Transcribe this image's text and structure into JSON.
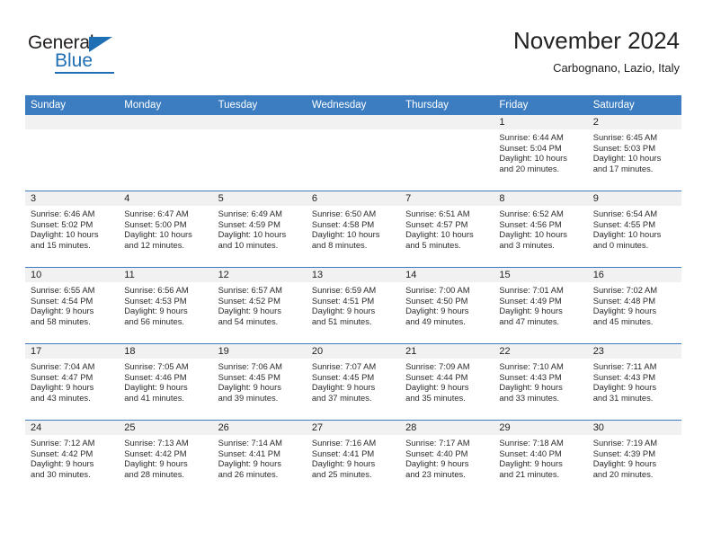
{
  "brand": {
    "name_part1": "General",
    "name_part2": "Blue"
  },
  "header": {
    "title": "November 2024",
    "location": "Carbognano, Lazio, Italy"
  },
  "colors": {
    "header_blue": "#3b7dc0",
    "brand_blue": "#1f6fb5",
    "daynum_band": "#f1f1f1"
  },
  "calendar": {
    "weekday_headers": [
      "Sunday",
      "Monday",
      "Tuesday",
      "Wednesday",
      "Thursday",
      "Friday",
      "Saturday"
    ],
    "weeks": [
      [
        {
          "day": "",
          "lines": []
        },
        {
          "day": "",
          "lines": []
        },
        {
          "day": "",
          "lines": []
        },
        {
          "day": "",
          "lines": []
        },
        {
          "day": "",
          "lines": []
        },
        {
          "day": "1",
          "lines": [
            "Sunrise: 6:44 AM",
            "Sunset: 5:04 PM",
            "Daylight: 10 hours",
            "and 20 minutes."
          ]
        },
        {
          "day": "2",
          "lines": [
            "Sunrise: 6:45 AM",
            "Sunset: 5:03 PM",
            "Daylight: 10 hours",
            "and 17 minutes."
          ]
        }
      ],
      [
        {
          "day": "3",
          "lines": [
            "Sunrise: 6:46 AM",
            "Sunset: 5:02 PM",
            "Daylight: 10 hours",
            "and 15 minutes."
          ]
        },
        {
          "day": "4",
          "lines": [
            "Sunrise: 6:47 AM",
            "Sunset: 5:00 PM",
            "Daylight: 10 hours",
            "and 12 minutes."
          ]
        },
        {
          "day": "5",
          "lines": [
            "Sunrise: 6:49 AM",
            "Sunset: 4:59 PM",
            "Daylight: 10 hours",
            "and 10 minutes."
          ]
        },
        {
          "day": "6",
          "lines": [
            "Sunrise: 6:50 AM",
            "Sunset: 4:58 PM",
            "Daylight: 10 hours",
            "and 8 minutes."
          ]
        },
        {
          "day": "7",
          "lines": [
            "Sunrise: 6:51 AM",
            "Sunset: 4:57 PM",
            "Daylight: 10 hours",
            "and 5 minutes."
          ]
        },
        {
          "day": "8",
          "lines": [
            "Sunrise: 6:52 AM",
            "Sunset: 4:56 PM",
            "Daylight: 10 hours",
            "and 3 minutes."
          ]
        },
        {
          "day": "9",
          "lines": [
            "Sunrise: 6:54 AM",
            "Sunset: 4:55 PM",
            "Daylight: 10 hours",
            "and 0 minutes."
          ]
        }
      ],
      [
        {
          "day": "10",
          "lines": [
            "Sunrise: 6:55 AM",
            "Sunset: 4:54 PM",
            "Daylight: 9 hours",
            "and 58 minutes."
          ]
        },
        {
          "day": "11",
          "lines": [
            "Sunrise: 6:56 AM",
            "Sunset: 4:53 PM",
            "Daylight: 9 hours",
            "and 56 minutes."
          ]
        },
        {
          "day": "12",
          "lines": [
            "Sunrise: 6:57 AM",
            "Sunset: 4:52 PM",
            "Daylight: 9 hours",
            "and 54 minutes."
          ]
        },
        {
          "day": "13",
          "lines": [
            "Sunrise: 6:59 AM",
            "Sunset: 4:51 PM",
            "Daylight: 9 hours",
            "and 51 minutes."
          ]
        },
        {
          "day": "14",
          "lines": [
            "Sunrise: 7:00 AM",
            "Sunset: 4:50 PM",
            "Daylight: 9 hours",
            "and 49 minutes."
          ]
        },
        {
          "day": "15",
          "lines": [
            "Sunrise: 7:01 AM",
            "Sunset: 4:49 PM",
            "Daylight: 9 hours",
            "and 47 minutes."
          ]
        },
        {
          "day": "16",
          "lines": [
            "Sunrise: 7:02 AM",
            "Sunset: 4:48 PM",
            "Daylight: 9 hours",
            "and 45 minutes."
          ]
        }
      ],
      [
        {
          "day": "17",
          "lines": [
            "Sunrise: 7:04 AM",
            "Sunset: 4:47 PM",
            "Daylight: 9 hours",
            "and 43 minutes."
          ]
        },
        {
          "day": "18",
          "lines": [
            "Sunrise: 7:05 AM",
            "Sunset: 4:46 PM",
            "Daylight: 9 hours",
            "and 41 minutes."
          ]
        },
        {
          "day": "19",
          "lines": [
            "Sunrise: 7:06 AM",
            "Sunset: 4:45 PM",
            "Daylight: 9 hours",
            "and 39 minutes."
          ]
        },
        {
          "day": "20",
          "lines": [
            "Sunrise: 7:07 AM",
            "Sunset: 4:45 PM",
            "Daylight: 9 hours",
            "and 37 minutes."
          ]
        },
        {
          "day": "21",
          "lines": [
            "Sunrise: 7:09 AM",
            "Sunset: 4:44 PM",
            "Daylight: 9 hours",
            "and 35 minutes."
          ]
        },
        {
          "day": "22",
          "lines": [
            "Sunrise: 7:10 AM",
            "Sunset: 4:43 PM",
            "Daylight: 9 hours",
            "and 33 minutes."
          ]
        },
        {
          "day": "23",
          "lines": [
            "Sunrise: 7:11 AM",
            "Sunset: 4:43 PM",
            "Daylight: 9 hours",
            "and 31 minutes."
          ]
        }
      ],
      [
        {
          "day": "24",
          "lines": [
            "Sunrise: 7:12 AM",
            "Sunset: 4:42 PM",
            "Daylight: 9 hours",
            "and 30 minutes."
          ]
        },
        {
          "day": "25",
          "lines": [
            "Sunrise: 7:13 AM",
            "Sunset: 4:42 PM",
            "Daylight: 9 hours",
            "and 28 minutes."
          ]
        },
        {
          "day": "26",
          "lines": [
            "Sunrise: 7:14 AM",
            "Sunset: 4:41 PM",
            "Daylight: 9 hours",
            "and 26 minutes."
          ]
        },
        {
          "day": "27",
          "lines": [
            "Sunrise: 7:16 AM",
            "Sunset: 4:41 PM",
            "Daylight: 9 hours",
            "and 25 minutes."
          ]
        },
        {
          "day": "28",
          "lines": [
            "Sunrise: 7:17 AM",
            "Sunset: 4:40 PM",
            "Daylight: 9 hours",
            "and 23 minutes."
          ]
        },
        {
          "day": "29",
          "lines": [
            "Sunrise: 7:18 AM",
            "Sunset: 4:40 PM",
            "Daylight: 9 hours",
            "and 21 minutes."
          ]
        },
        {
          "day": "30",
          "lines": [
            "Sunrise: 7:19 AM",
            "Sunset: 4:39 PM",
            "Daylight: 9 hours",
            "and 20 minutes."
          ]
        }
      ]
    ]
  }
}
